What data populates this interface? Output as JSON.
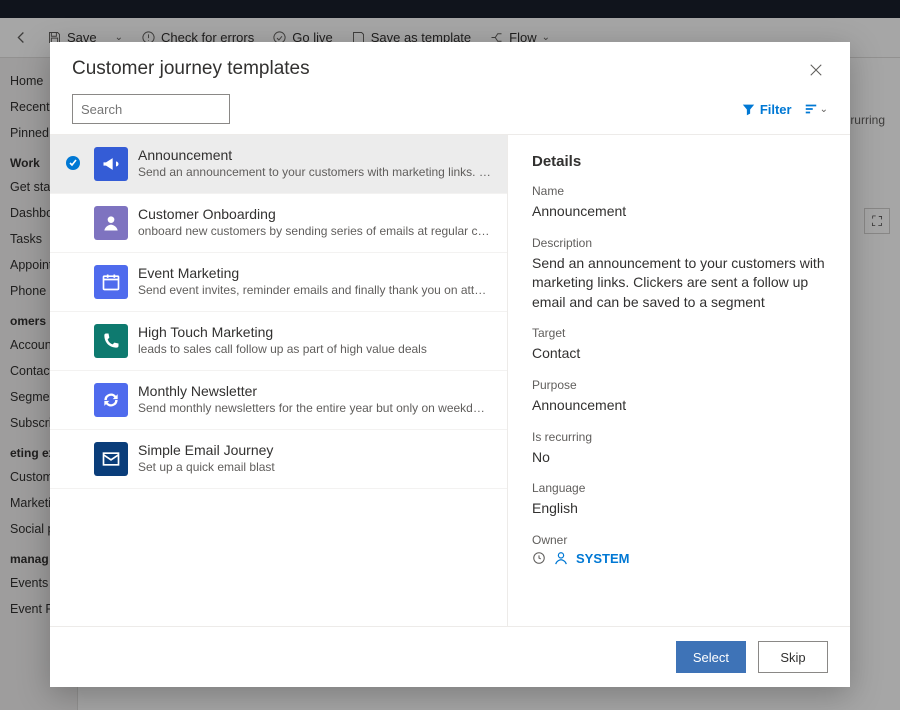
{
  "cmdbar": {
    "save": "Save",
    "check": "Check for errors",
    "golive": "Go live",
    "saveas": "Save as template",
    "flow": "Flow"
  },
  "sidebar": {
    "items1": [
      "Home",
      "Recent",
      "Pinned"
    ],
    "section_work": "Work",
    "items2": [
      "Get start",
      "Dashboa",
      "Tasks",
      "Appointi",
      "Phone C"
    ],
    "section_customers": "omers",
    "items3": [
      "Account",
      "Contacts",
      "Segmen",
      "Subscrip"
    ],
    "section_marketing": "eting ex",
    "items4": [
      "Custome",
      "Marketin",
      "Social p"
    ],
    "section_manage": "manag",
    "items5": [
      "Events",
      "Event Registrations"
    ]
  },
  "bg_rt": {
    "rurring": "rurring"
  },
  "modal": {
    "title": "Customer journey templates",
    "search_placeholder": "Search",
    "filter_label": "Filter",
    "select": "Select",
    "skip": "Skip",
    "templates": [
      {
        "title": "Announcement",
        "desc": "Send an announcement to your customers with marketing links. Clickers are sent a...",
        "color": "#345cd6",
        "icon": "megaphone",
        "selected": true
      },
      {
        "title": "Customer Onboarding",
        "desc": "onboard new customers by sending series of emails at regular cadence",
        "color": "#7e73c0",
        "icon": "user"
      },
      {
        "title": "Event Marketing",
        "desc": "Send event invites, reminder emails and finally thank you on attending",
        "color": "#4f6bed",
        "icon": "calendar"
      },
      {
        "title": "High Touch Marketing",
        "desc": "leads to sales call follow up as part of high value deals",
        "color": "#0e7a6f",
        "icon": "phone"
      },
      {
        "title": "Monthly Newsletter",
        "desc": "Send monthly newsletters for the entire year but only on weekday afternoons",
        "color": "#4f6bed",
        "icon": "cycle"
      },
      {
        "title": "Simple Email Journey",
        "desc": "Set up a quick email blast",
        "color": "#0a3d7a",
        "icon": "mail"
      }
    ],
    "details": {
      "heading": "Details",
      "name_label": "Name",
      "name_value": "Announcement",
      "desc_label": "Description",
      "desc_value": "Send an announcement to your customers with marketing links. Clickers are sent a follow up email and can be saved to a segment",
      "target_label": "Target",
      "target_value": "Contact",
      "purpose_label": "Purpose",
      "purpose_value": "Announcement",
      "recurring_label": "Is recurring",
      "recurring_value": "No",
      "lang_label": "Language",
      "lang_value": "English",
      "owner_label": "Owner",
      "owner_value": "SYSTEM"
    }
  }
}
